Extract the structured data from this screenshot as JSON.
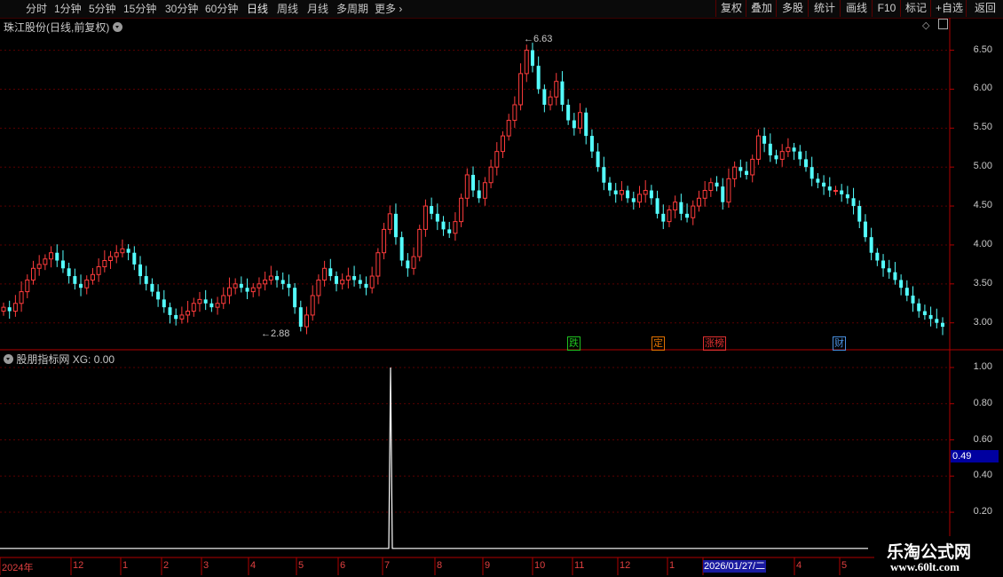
{
  "toolbar": {
    "periods": [
      "分时",
      "1分钟",
      "5分钟",
      "15分钟",
      "30分钟",
      "60分钟",
      "日线",
      "周线",
      "月线",
      "多周期",
      "更多"
    ],
    "active": "日线",
    "right_buttons": [
      "复权",
      "叠加",
      "多股",
      "统计",
      "画线",
      "F10",
      "标记",
      "+自选",
      "返回"
    ]
  },
  "main_panel": {
    "title": "珠江股份(日线,前复权)",
    "high_label": "6.63",
    "low_label": "2.88",
    "y_labels": [
      "6.50",
      "6.00",
      "5.50",
      "5.00",
      "4.50",
      "4.00",
      "3.50",
      "3.00"
    ],
    "event_tags": [
      {
        "text": "跌",
        "color": "#20c020"
      },
      {
        "text": "定",
        "color": "#e07000"
      },
      {
        "text": "涨榜",
        "color": "#e03030"
      },
      {
        "text": "财",
        "color": "#4a90e0"
      }
    ]
  },
  "indicator_panel": {
    "title": "股朋指标网",
    "value_label": "XG: 0.00",
    "y_labels": [
      "1.00",
      "0.80",
      "0.60",
      "0.40",
      "0.20"
    ],
    "current_value": "0.49"
  },
  "x_axis": {
    "labels": [
      "2024年",
      "12",
      "1",
      "2",
      "3",
      "4",
      "5",
      "6",
      "7",
      "8",
      "9",
      "10",
      "11",
      "12",
      "1",
      "2026/01/27/二",
      "4",
      "5"
    ]
  },
  "watermark": {
    "title": "乐淘公式网",
    "url": "www.60lt.com"
  },
  "colors": {
    "up": "#ff3c3c",
    "down": "#54ffff",
    "grid": "#5a0000",
    "axis": "#b00000"
  },
  "chart_data": {
    "type": "candlestick",
    "price_range": [
      2.88,
      6.63
    ],
    "ylim": [
      2.78,
      6.78
    ],
    "closes": [
      3.2,
      3.15,
      3.25,
      3.4,
      3.55,
      3.7,
      3.75,
      3.82,
      3.9,
      3.8,
      3.7,
      3.6,
      3.5,
      3.45,
      3.55,
      3.62,
      3.72,
      3.8,
      3.85,
      3.9,
      3.95,
      3.9,
      3.75,
      3.6,
      3.5,
      3.4,
      3.3,
      3.2,
      3.1,
      3.05,
      3.1,
      3.15,
      3.25,
      3.3,
      3.25,
      3.2,
      3.25,
      3.35,
      3.45,
      3.5,
      3.45,
      3.4,
      3.45,
      3.5,
      3.55,
      3.6,
      3.55,
      3.5,
      3.45,
      3.2,
      2.95,
      3.1,
      3.35,
      3.55,
      3.7,
      3.6,
      3.5,
      3.55,
      3.6,
      3.55,
      3.5,
      3.45,
      3.6,
      3.9,
      4.2,
      4.4,
      4.1,
      3.8,
      3.7,
      3.85,
      4.2,
      4.5,
      4.4,
      4.3,
      4.2,
      4.15,
      4.3,
      4.6,
      4.9,
      4.7,
      4.6,
      4.8,
      5.0,
      5.2,
      5.4,
      5.6,
      5.8,
      6.2,
      6.5,
      6.3,
      6.0,
      5.8,
      5.9,
      6.1,
      5.8,
      5.6,
      5.5,
      5.7,
      5.4,
      5.2,
      5.0,
      4.8,
      4.7,
      4.65,
      4.7,
      4.6,
      4.55,
      4.65,
      4.7,
      4.6,
      4.4,
      4.3,
      4.45,
      4.55,
      4.4,
      4.35,
      4.5,
      4.6,
      4.7,
      4.8,
      4.75,
      4.55,
      4.85,
      5.0,
      4.95,
      4.9,
      5.1,
      5.4,
      5.3,
      5.15,
      5.1,
      5.2,
      5.25,
      5.2,
      5.1,
      5.0,
      4.85,
      4.8,
      4.75,
      4.7,
      4.7,
      4.65,
      4.6,
      4.5,
      4.3,
      4.1,
      3.9,
      3.8,
      3.7,
      3.65,
      3.55,
      3.45,
      3.35,
      3.25,
      3.15,
      3.1,
      3.05,
      3.0,
      2.95
    ],
    "indicator": {
      "type": "spike",
      "value": 1.0,
      "position_label": "7"
    }
  }
}
